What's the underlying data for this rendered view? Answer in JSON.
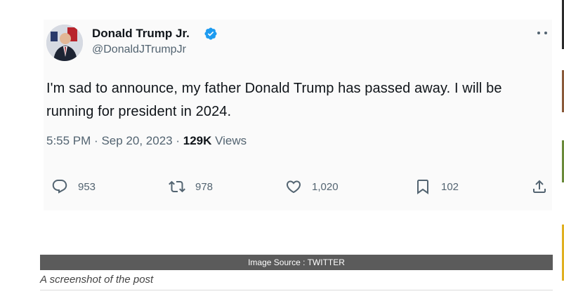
{
  "tweet": {
    "author_name": "Donald Trump Jr.",
    "author_handle": "@DonaldJTrumpJr",
    "text": "I'm sad to announce, my father Donald Trump has passed away. I will be running for president in 2024.",
    "time": "5:55 PM",
    "separator": "·",
    "date": "Sep 20, 2023",
    "views_count": "129K",
    "views_label": "Views",
    "replies": "953",
    "retweets": "978",
    "likes": "1,020",
    "bookmarks": "102"
  },
  "caption": {
    "source": "Image Source : TWITTER",
    "description": "A screenshot of the post"
  },
  "icons": {
    "verified": "verified-badge-icon",
    "more": "more-icon",
    "reply": "reply-icon",
    "retweet": "retweet-icon",
    "like": "heart-icon",
    "bookmark": "bookmark-icon",
    "share": "share-icon"
  },
  "colors": {
    "verified_blue": "#1d9bf0",
    "text": "#0f1419",
    "secondary": "#536471",
    "caption_bar": "#5b5b5b"
  }
}
